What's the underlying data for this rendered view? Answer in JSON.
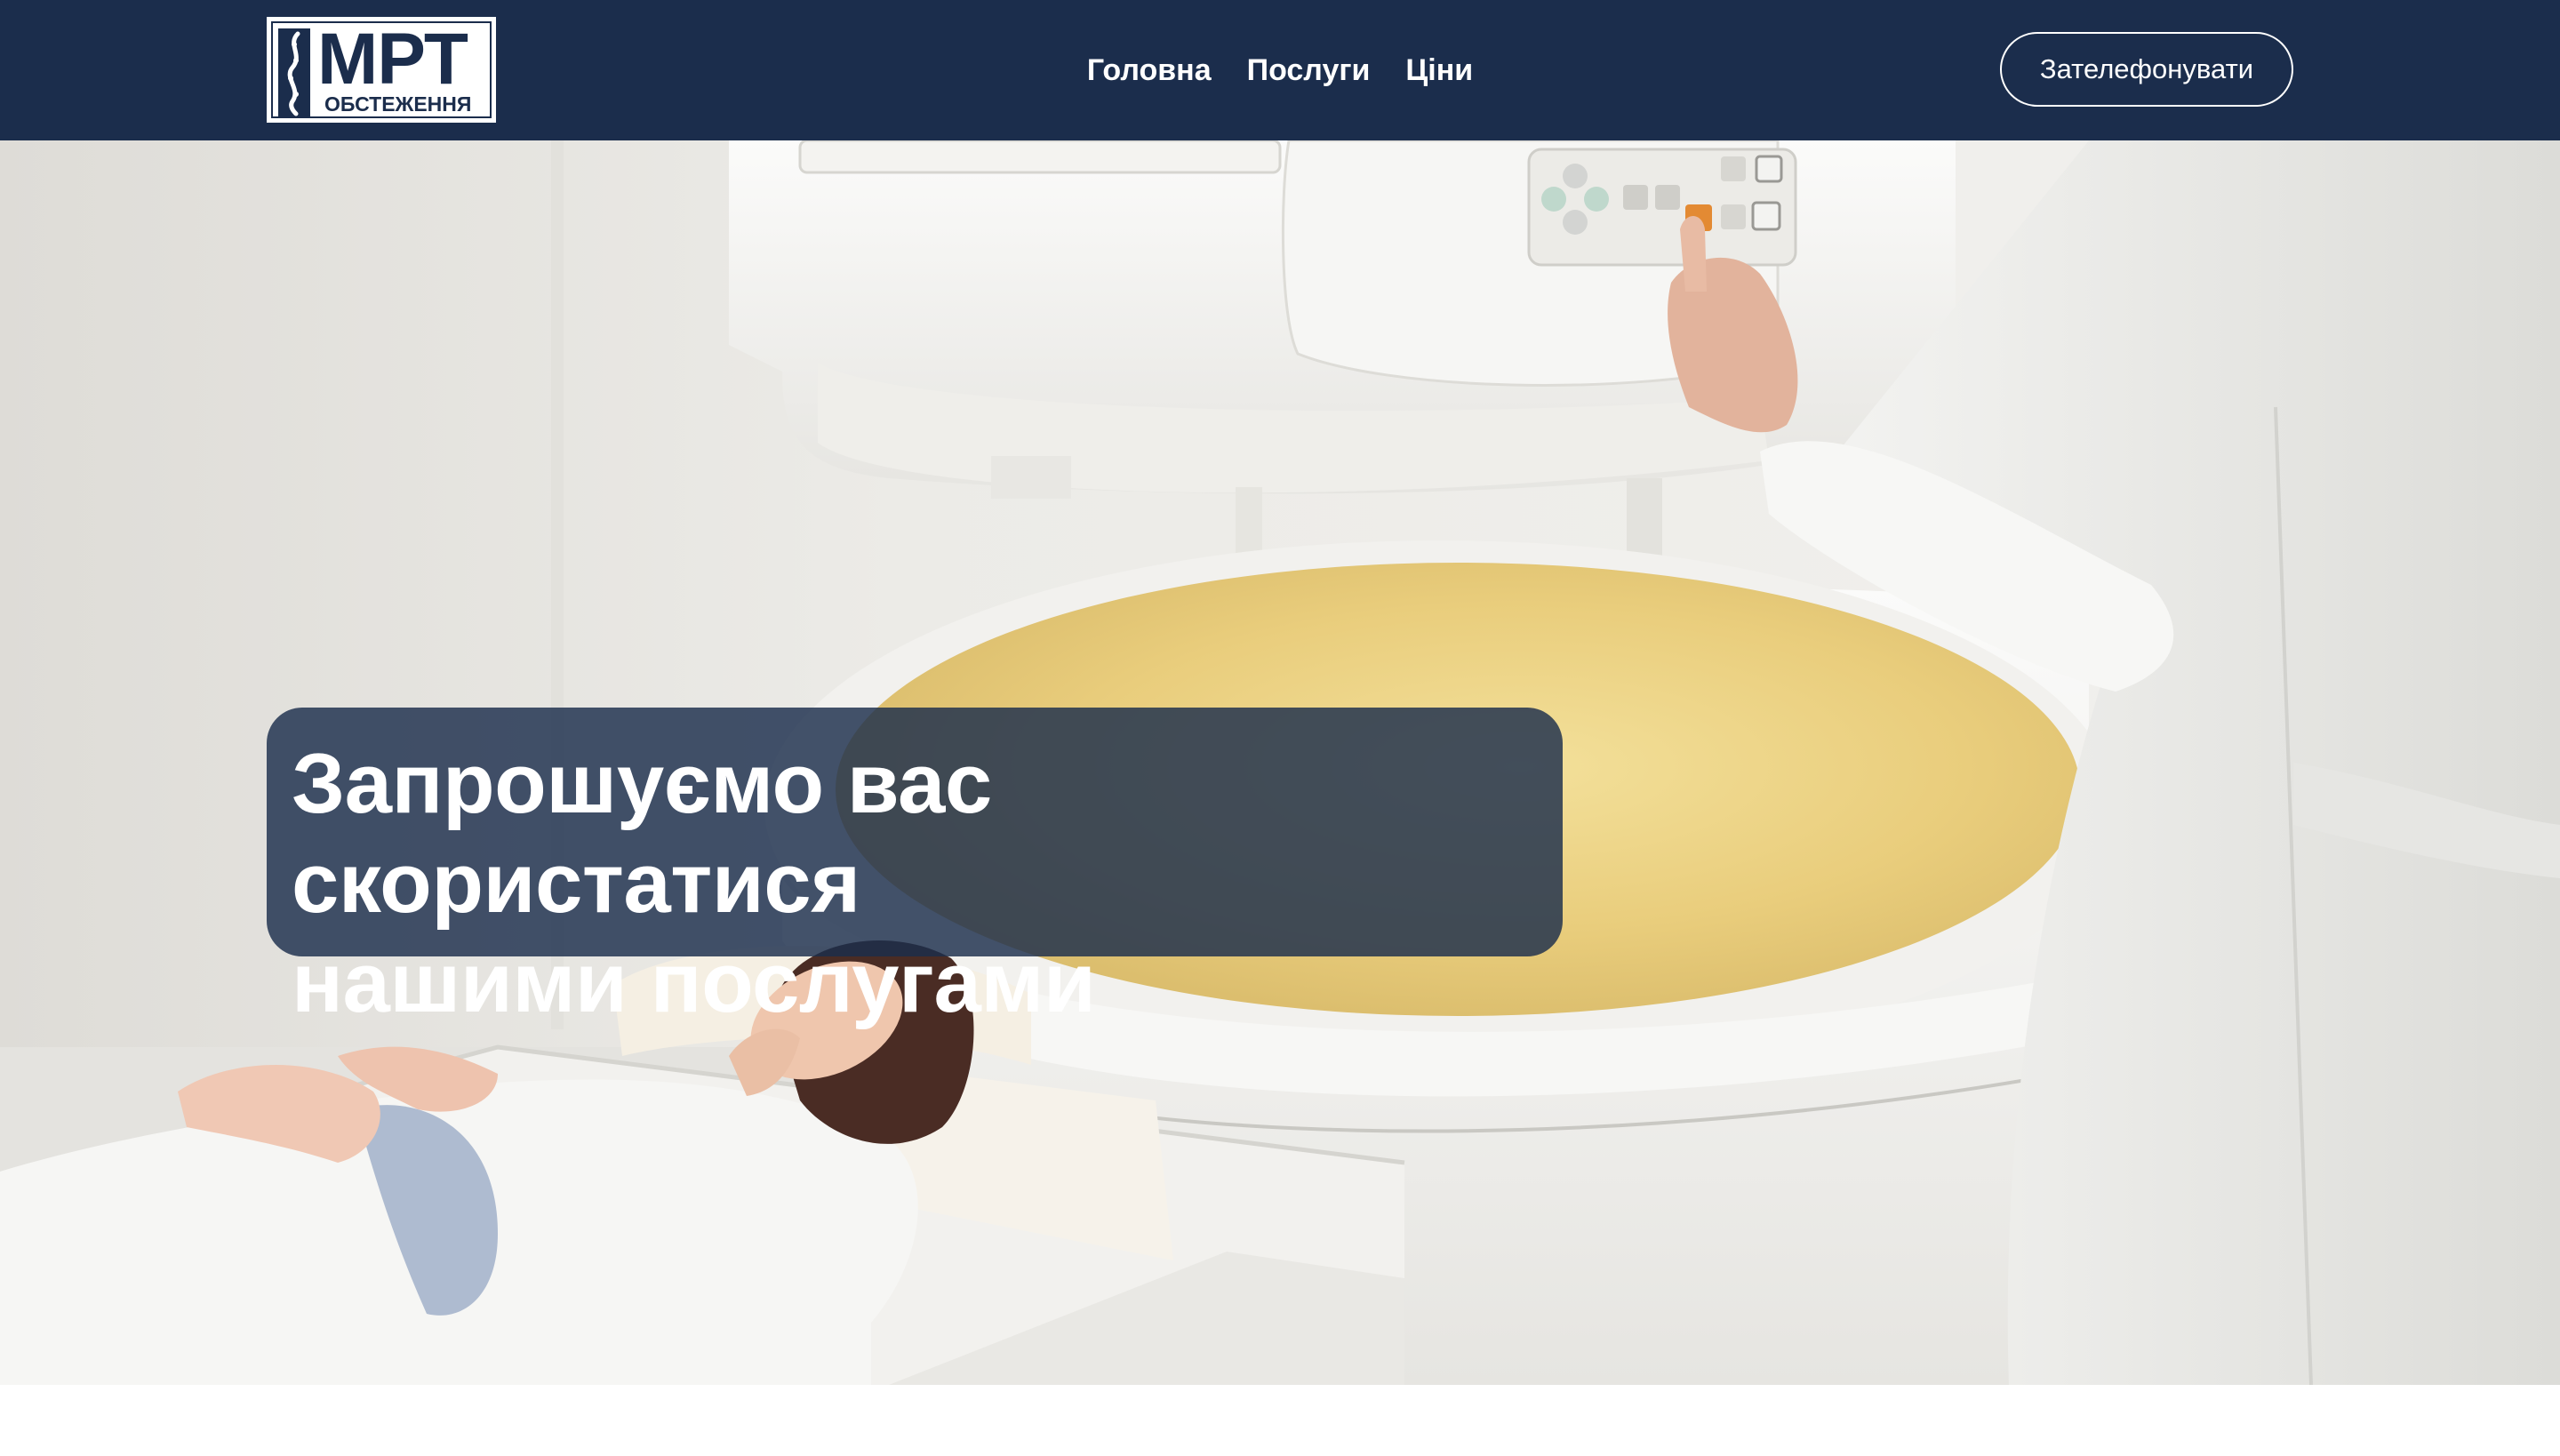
{
  "header": {
    "logo": {
      "main": "МРТ",
      "sub": "ОБСТЕЖЕННЯ"
    },
    "nav": [
      {
        "label": "Головна"
      },
      {
        "label": "Послуги"
      },
      {
        "label": "Ціни"
      }
    ],
    "call_button": "Зателефонувати"
  },
  "hero": {
    "headline_line1": "Запрошуємо вас скористатися",
    "headline_line2": "нашими послугами",
    "image": "MRI scanner with patient lying on the table and a doctor in a white coat pressing the control panel"
  },
  "colors": {
    "navbar": "#1b2d4c",
    "headline_box": "#1b2d4c",
    "text_light": "#ffffff"
  }
}
